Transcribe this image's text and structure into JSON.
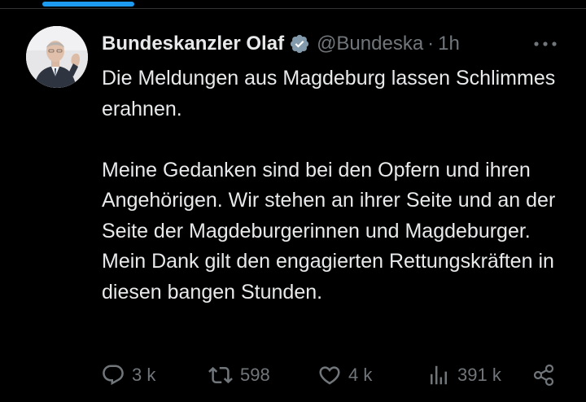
{
  "tweet": {
    "author": {
      "display_name": "Bundeskanzler Olaf",
      "verified": true,
      "handle": "@Bundeska",
      "avatar_icon": "avatar-portrait-icon"
    },
    "separator": "·",
    "timestamp": "1h",
    "paragraphs": [
      "Die Meldungen aus Magdeburg lassen Schlimmes erahnen.",
      "Meine Gedanken sind bei den Opfern und ihren Angehörigen. Wir stehen an ihrer Seite und an der Seite der Magdeburgerinnen und Magdeburger. Mein Dank gilt den engagierten Rettungskräften in diesen bangen Stunden."
    ],
    "actions": {
      "replies": "3 k",
      "retweets": "598",
      "likes": "4 k",
      "views": "391 k"
    }
  },
  "colors": {
    "background": "#000000",
    "text_primary": "#e7e9ea",
    "text_secondary": "#71767b",
    "accent": "#1d9bf0",
    "divider": "#2f3336"
  },
  "icons": {
    "verified": "verified-badge-icon",
    "more": "more-dots-icon",
    "reply": "reply-icon",
    "retweet": "retweet-icon",
    "like": "like-icon",
    "views": "views-icon",
    "share": "share-icon"
  }
}
